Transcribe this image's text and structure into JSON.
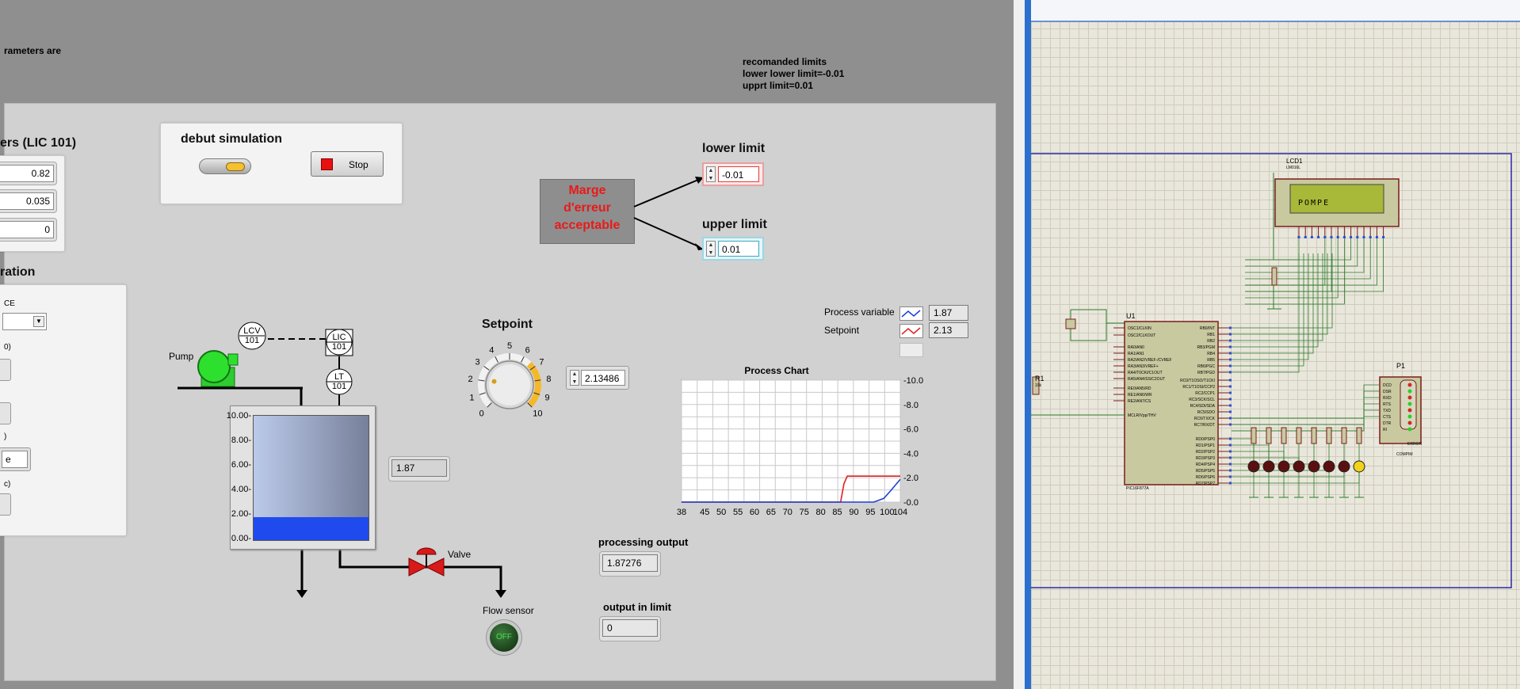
{
  "header": {
    "note_fragment": "rameters are",
    "limits_note": [
      "recomanded limits",
      "lower lower limit=-0.01",
      "upprt limit=0.01"
    ]
  },
  "params": {
    "title": "ers (LIC 101)",
    "values": [
      "0.82",
      "0.035",
      "0"
    ]
  },
  "config": {
    "title": "ration",
    "ce_label": "CE",
    "frag_0": "0)",
    "frag_e": "e",
    "frag_c": "c)",
    "frag_paren": ")"
  },
  "simulation": {
    "title": "debut simulation",
    "stop_label": "Stop"
  },
  "error_margin": {
    "label": "Marge d'erreur acceptable",
    "lower_label": "lower limit",
    "lower_value": "-0.01",
    "upper_label": "upper limit",
    "upper_value": "0.01"
  },
  "process": {
    "pump_label": "Pump",
    "lcv_tag": [
      "LCV",
      "101"
    ],
    "lic_tag": [
      "LIC",
      "101"
    ],
    "lt_tag": [
      "LT",
      "101"
    ],
    "tank_scale": [
      "10.00-",
      "8.00-",
      "6.00-",
      "4.00-",
      "2.00-",
      "0.00-"
    ],
    "tank_level": 0.187,
    "level_value": "1.87",
    "valve_label": "Valve",
    "flow_label": "Flow sensor",
    "flow_state": "OFF"
  },
  "setpoint": {
    "title": "Setpoint",
    "value": "2.13486",
    "dial_ticks": [
      "0",
      "1",
      "2",
      "3",
      "4",
      "5",
      "6",
      "7",
      "8",
      "9",
      "10"
    ]
  },
  "legend": {
    "items": [
      {
        "name": "Process variable",
        "value": "1.87",
        "color": "#1f3fd6"
      },
      {
        "name": "Setpoint",
        "value": "2.13",
        "color": "#e02020"
      }
    ]
  },
  "outputs": {
    "processing_label": "processing output",
    "processing_value": "1.87276",
    "limit_label": "output in limit",
    "limit_value": "0"
  },
  "chart_data": {
    "type": "line",
    "title": "Process Chart",
    "xlim": [
      38,
      104
    ],
    "ylim": [
      0,
      10
    ],
    "x_ticks": [
      "38",
      "45",
      "50",
      "55",
      "60",
      "65",
      "70",
      "75",
      "80",
      "85",
      "90",
      "95",
      "100",
      "104"
    ],
    "y_ticks": [
      "-10.0",
      "-8.0",
      "-6.0",
      "-4.0",
      "-2.0",
      "-0.0"
    ],
    "series": [
      {
        "name": "Setpoint",
        "color": "#e02020",
        "x": [
          38,
          86,
          87,
          88,
          104
        ],
        "y": [
          0,
          0,
          1.5,
          2.13,
          2.13
        ]
      },
      {
        "name": "Process variable",
        "color": "#1f3fd6",
        "x": [
          38,
          96,
          99,
          101,
          104
        ],
        "y": [
          0,
          0,
          0.3,
          0.9,
          1.87
        ]
      }
    ]
  },
  "proteus": {
    "lcd_label": "LCD1",
    "lcd_model": "LM016L",
    "lcd_text": "POMPE",
    "u1_label": "U1",
    "u1_model": "PIC16F877A",
    "p1_label": "P1",
    "p1_model": "COMPIM",
    "p1_error": "ERROR",
    "r1_label": "R1",
    "r1_value": "10k",
    "left_pins": [
      "OSC1/CLKIN",
      "OSC2/CLKOUT",
      "RA0/AN0",
      "RA1/AN1",
      "RA2/AN2/VREF-/CVREF",
      "RA3/AN3/VREF+",
      "RA4/T0CKI/C1OUT",
      "RA5/AN4/SS/C2OUT",
      "RE0/AN5/RD",
      "RE1/AN6/WR",
      "RE2/AN7/CS",
      "MCLR/Vpp/THV"
    ],
    "right_pins": [
      "RB0/INT",
      "RB1",
      "RB2",
      "RB3/PGM",
      "RB4",
      "RB5",
      "RB6/PGC",
      "RB7/PGD",
      "RC0/T1OSO/T1CKI",
      "RC1/T1OSI/CCP2",
      "RC2/CCP1",
      "RC3/SCK/SCL",
      "RC4/SDI/SDA",
      "RC5/SDO",
      "RC6/TX/CK",
      "RC7/RX/DT",
      "RD0/PSP0",
      "RD1/PSP1",
      "RD2/PSP2",
      "RD3/PSP3",
      "RD4/PSP4",
      "RD5/PSP5",
      "RD6/PSP6",
      "RD7/PSP7"
    ],
    "com_pins": [
      "DCD",
      "DSR",
      "RXD",
      "RTS",
      "TXD",
      "CTS",
      "DTR",
      "RI"
    ],
    "led_colors": [
      "#5a1010",
      "#5a1010",
      "#5a1010",
      "#5a1010",
      "#5a1010",
      "#5a1010",
      "#5a1010",
      "#f2d21c"
    ]
  }
}
